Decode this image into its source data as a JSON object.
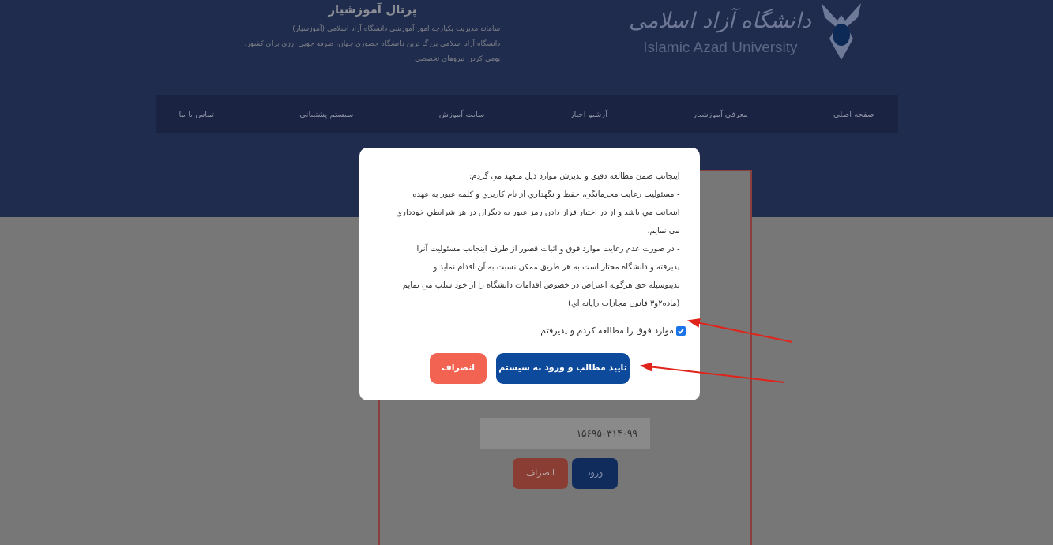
{
  "header": {
    "title": "پرتال آموزشیار",
    "description": [
      "سامانه مدیریت یکپارچه امور آموزشی دانشگاه آزاد اسلامی (آموزشیار)",
      "دانشگاه آزاد اسلامی بزرگ ترین دانشگاه حضوری جهان، صرفه جویی ارزی برای کشور،",
      "بومی کردن نیروهای تخصصی"
    ],
    "logo_persian": "دانشگاه آزاد اسلامی",
    "logo_english": "Islamic Azad University"
  },
  "nav": [
    "صفحه اصلی",
    "معرفی آموزشیار",
    "آرشیو اخبار",
    "سایت آموزش",
    "سیستم پشتیبانی",
    "تماس با ما"
  ],
  "background_form": {
    "field_value": "۱۵۶۹۵۰۳۱۴۰۹۹",
    "buttons": [
      {
        "label": "ورود",
        "kind": "primary"
      },
      {
        "label": "انصراف",
        "kind": "cancel"
      }
    ]
  },
  "modal": {
    "terms": [
      "اینجانب ضمن مطالعه دقیق و پذیرش موارد ذیل متعهد مي گردم:",
      "- مسئولیت رعایت محرمانگي، حفظ و نگهداري از نام کاربري و کلمه عبور به عهده",
      "اینجانب مي باشد و از در اختیار قرار دادن رمز عبور به دیگران در هر شرایطي خودداري",
      "مي نمایم.",
      "- در صورت عدم رعایت موارد فوق و اثبات قصور از طرف اینجانب مسئولیت آنرا",
      "پذیرفته و دانشگاه مختار است به هر طریق ممکن نسبت به آن اقدام نماید و",
      "بدینوسیله حق هرگونه اعتراض در خصوص اقدامات دانشگاه را از خود سلب مي نمایم",
      "(ماده۲و۳ قانون مجازات رایانه اي)"
    ],
    "agree": {
      "label": "موارد فوق را مطالعه کردم و پذیرفتم",
      "checked": true
    },
    "buttons": [
      {
        "label": "تایید مطالب و ورود به سیستم",
        "kind": "primary"
      },
      {
        "label": "انصراف",
        "kind": "cancel"
      }
    ]
  }
}
